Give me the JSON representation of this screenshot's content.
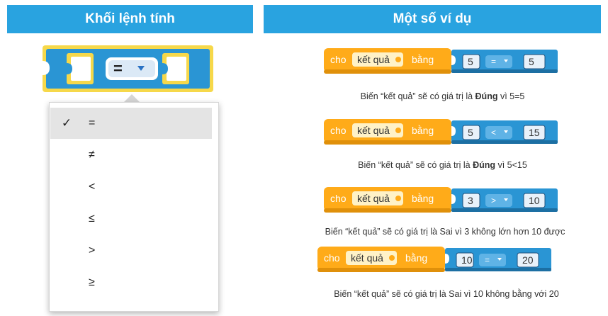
{
  "headers": {
    "left": "Khối lệnh tính",
    "right": "Một số ví dụ"
  },
  "compare_block": {
    "operator": "=",
    "dropdown_icon": "triangle-down-icon"
  },
  "menu": {
    "check_icon": "checkmark-icon",
    "items": [
      {
        "symbol": "=",
        "selected": true
      },
      {
        "symbol": "≠",
        "selected": false
      },
      {
        "symbol": "<",
        "selected": false
      },
      {
        "symbol": "≤",
        "selected": false
      },
      {
        "symbol": ">",
        "selected": false
      },
      {
        "symbol": "≥",
        "selected": false
      }
    ]
  },
  "examples": [
    {
      "set_word": "cho",
      "variable": "kết quả",
      "to_word": "bằng",
      "a": "5",
      "op": "=",
      "b": "5",
      "caption": "Biến “kết quả” sẽ có giá trị là ",
      "caption_bold": "Đúng",
      "caption_tail": " vì 5=5"
    },
    {
      "set_word": "cho",
      "variable": "kết quả",
      "to_word": "bằng",
      "a": "5",
      "op": "<",
      "b": "15",
      "caption": "Biến “kết quả” sẽ có giá trị là ",
      "caption_bold": "Đúng",
      "caption_tail": " vì 5<15"
    },
    {
      "set_word": "cho",
      "variable": "kết quả",
      "to_word": "bằng",
      "a": "3",
      "op": ">",
      "b": "10",
      "caption": "Biến “kết quả” sẽ có giá trị là Sai vì 3 không lớn hơn 10 được",
      "caption_bold": "",
      "caption_tail": ""
    },
    {
      "set_word": "cho",
      "variable": "kết quả",
      "to_word": "bằng",
      "a": "10",
      "op": "=",
      "b": "20",
      "caption": "Biến “kết quả” sẽ có giá trị là Sai vì 10 không bằng với 20",
      "caption_bold": "",
      "caption_tail": ""
    }
  ],
  "colors": {
    "header_bg": "#29a3e0",
    "logic_blue": "#2a95d4",
    "logic_dark": "#1c6fa3",
    "variable_orange": "#ffab19",
    "variable_dark": "#e0900a",
    "highlight_yellow": "#f6d84a",
    "number_fill": "#e8f1fa"
  }
}
